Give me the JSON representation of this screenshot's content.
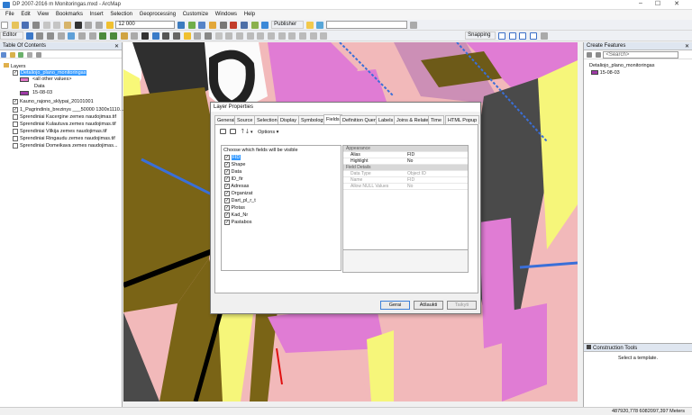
{
  "window": {
    "title": "DP 2007-2016 m Monitoringas.mxd - ArcMap"
  },
  "menu": [
    "File",
    "Edit",
    "View",
    "Bookmarks",
    "Insert",
    "Selection",
    "Geoprocessing",
    "Customize",
    "Windows",
    "Help"
  ],
  "toolbar": {
    "scale": "12 000",
    "publisher": "Publisher",
    "editor": "Editor",
    "snapping": "Snapping"
  },
  "toc": {
    "header": "Table Of Contents",
    "layers_label": "Layers",
    "items": [
      {
        "label": "Detaliojo_plano_monitoringas",
        "selected": true
      },
      {
        "label": "<all other values>"
      },
      {
        "label": "Data"
      },
      {
        "label": "15-08-03"
      },
      {
        "label": "Kauno_rajono_sklypai_20101001"
      },
      {
        "label": "1_Pagrindinis_brezinys ___50000 1300x1110..."
      },
      {
        "label": "Sprendiniai Kacergine zemes naudojimas.tif"
      },
      {
        "label": "Sprendiniai Kulautuva zemes naudojimas.tif"
      },
      {
        "label": "Sprendiniai Vilkija zemes naudojimas.tif"
      },
      {
        "label": "Sprendiniai Ringaudu zemes naudojimas.tif"
      },
      {
        "label": "Sprendiniai Domeikava zemes naudojimas..."
      }
    ],
    "colors": {
      "pink": "#e277c7",
      "purple": "#9e39a6"
    }
  },
  "dialog": {
    "title": "Layer Properties",
    "tabs": [
      "General",
      "Source",
      "Selection",
      "Display",
      "Symbology",
      "Fields",
      "Definition Query",
      "Labels",
      "Joins & Relates",
      "Time",
      "HTML Popup"
    ],
    "active_tab": "Fields",
    "options_label": "Options",
    "fields_caption": "Choose which fields will be visible",
    "fields": [
      "FID",
      "Shape",
      "Data",
      "ID_fir",
      "Adresas",
      "Organizat",
      "Dart_pl_r_t",
      "Plotas",
      "Kad_Nr",
      "Pastabos"
    ],
    "props": [
      {
        "group": "Appearance"
      },
      {
        "key": "Alias",
        "value": "FID"
      },
      {
        "key": "Highlight",
        "value": "No"
      },
      {
        "group": "Field Details"
      },
      {
        "key": "Data Type",
        "value": "Object ID",
        "disabled": true
      },
      {
        "key": "Name",
        "value": "FID",
        "disabled": true
      },
      {
        "key": "Allow NULL Values",
        "value": "No",
        "disabled": true
      }
    ],
    "buttons": {
      "ok": "Gerai",
      "cancel": "Atšaukti",
      "apply": "Taikyti"
    }
  },
  "create_features": {
    "header": "Create Features",
    "layer": "Detaliojo_plano_monitoringas",
    "item": "15-08-03",
    "search_placeholder": "<Search>"
  },
  "construction_tools": {
    "header": "Construction Tools",
    "hint": "Select a template."
  },
  "status": {
    "coords": "487920,778  6082097,397 Meters"
  }
}
